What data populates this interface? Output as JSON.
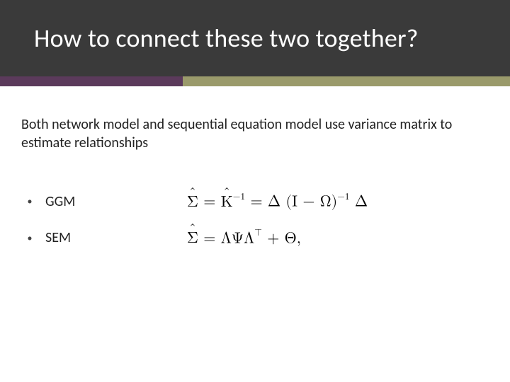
{
  "title": "How to connect these two together?",
  "intro": "Both network model and sequential equation model use variance matrix to estimate relationships",
  "items": [
    {
      "label": "GGM"
    },
    {
      "label": "SEM"
    }
  ],
  "formulas": {
    "ggm": {
      "lhs": "Σ",
      "rhs_k": "K",
      "rhs_rest1": " = Δ (I − Ω)",
      "exp1": "−1",
      "rhs_rest2": " Δ"
    },
    "sem": {
      "lhs": "Σ",
      "rhs": " = ΛΨΛ",
      "exp": "⊤",
      "tail": " + Θ,"
    }
  }
}
